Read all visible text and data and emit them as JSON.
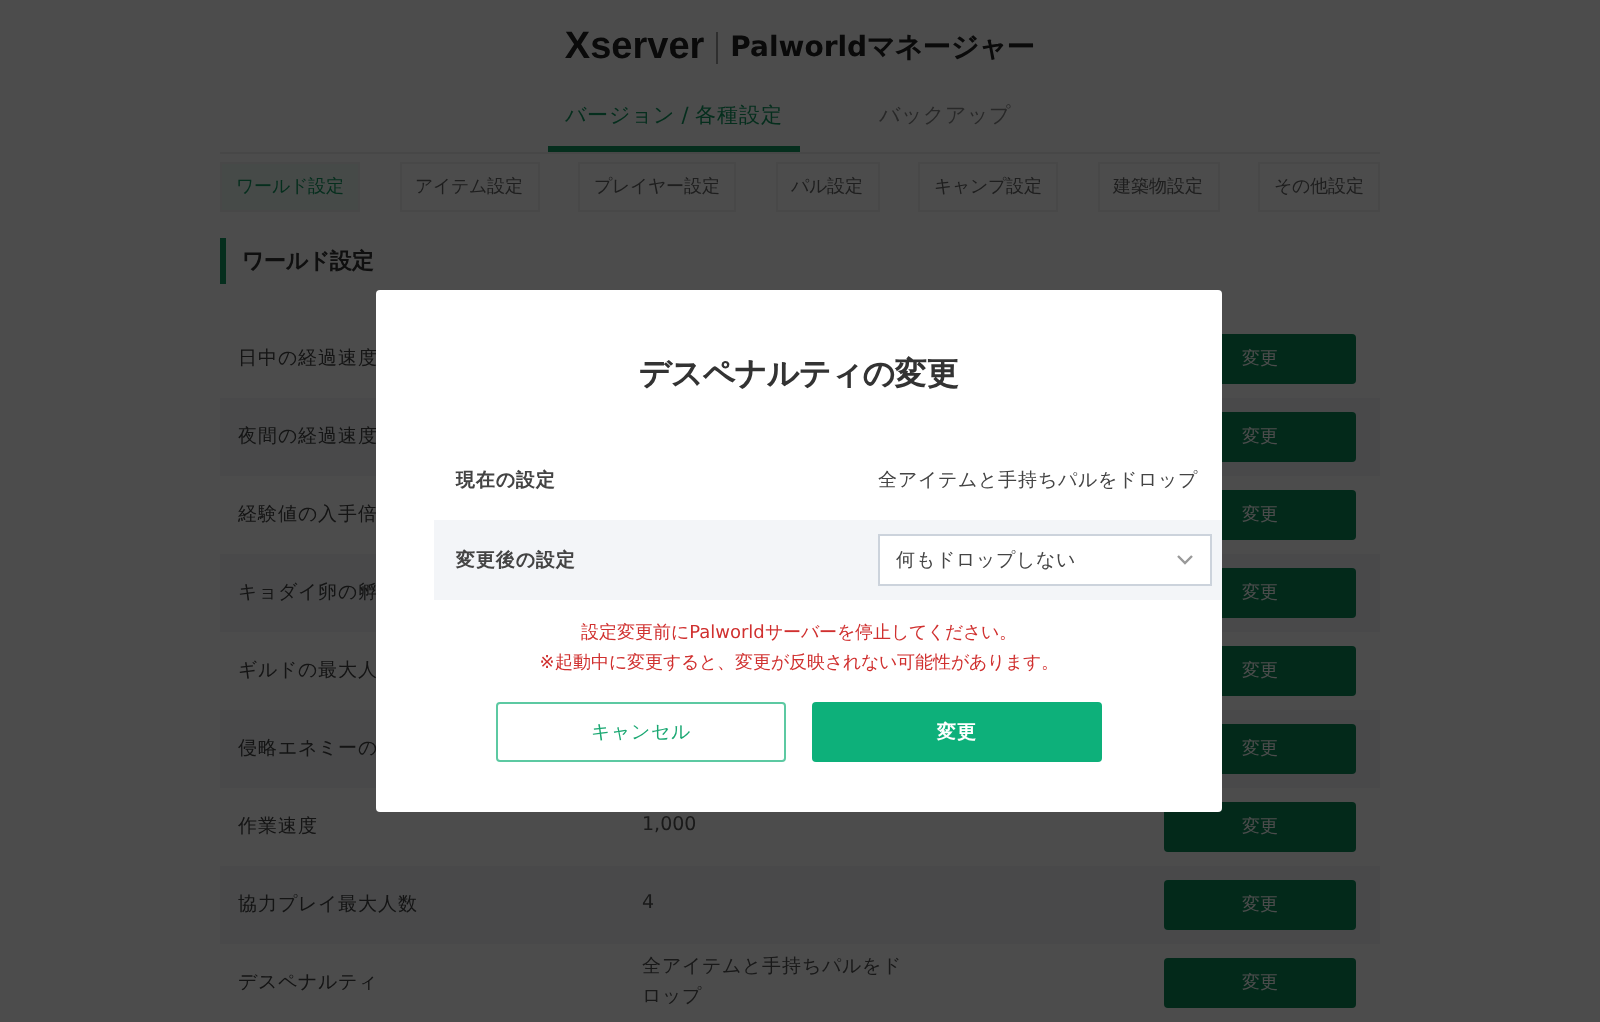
{
  "header": {
    "brand": "Xserver",
    "product": "Palworldマネージャー"
  },
  "tabs": [
    {
      "label": "バージョン / 各種設定",
      "selected": true
    },
    {
      "label": "バックアップ",
      "selected": false
    }
  ],
  "subtabs": [
    {
      "label": "ワールド設定",
      "selected": true
    },
    {
      "label": "アイテム設定",
      "selected": false
    },
    {
      "label": "プレイヤー設定",
      "selected": false
    },
    {
      "label": "パル設定",
      "selected": false
    },
    {
      "label": "キャンプ設定",
      "selected": false
    },
    {
      "label": "建築物設定",
      "selected": false
    },
    {
      "label": "その他設定",
      "selected": false
    }
  ],
  "section_title": "ワールド設定",
  "settings": [
    {
      "label": "日中の経過速度",
      "button": "変更"
    },
    {
      "label": "夜間の経過速度",
      "button": "変更"
    },
    {
      "label": "経験値の入手倍",
      "button": "変更"
    },
    {
      "label": "キョダイ卵の孵",
      "button": "変更"
    },
    {
      "label": "ギルドの最大人",
      "button": "変更"
    },
    {
      "label": "侵略エネミーの",
      "button": "変更"
    },
    {
      "label": "作業速度",
      "value": "1,000",
      "button": "変更"
    },
    {
      "label": "協力プレイ最大人数",
      "value": "4",
      "button": "変更"
    },
    {
      "label": "デスペナルティ",
      "value": "全アイテムと手持ちパルをドロップ",
      "button": "変更"
    }
  ],
  "dialog": {
    "title": "デスペナルティの変更",
    "current": {
      "label": "現在の設定",
      "value": "全アイテムと手持ちパルをドロップ"
    },
    "new": {
      "label": "変更後の設定",
      "value": "何もドロップしない"
    },
    "warnings": [
      "設定変更前にPalworldサーバーを停止してください。",
      "※起動中に変更すると、変更が反映されない可能性があります。"
    ],
    "cancel": "キャンセル",
    "confirm": "変更"
  }
}
